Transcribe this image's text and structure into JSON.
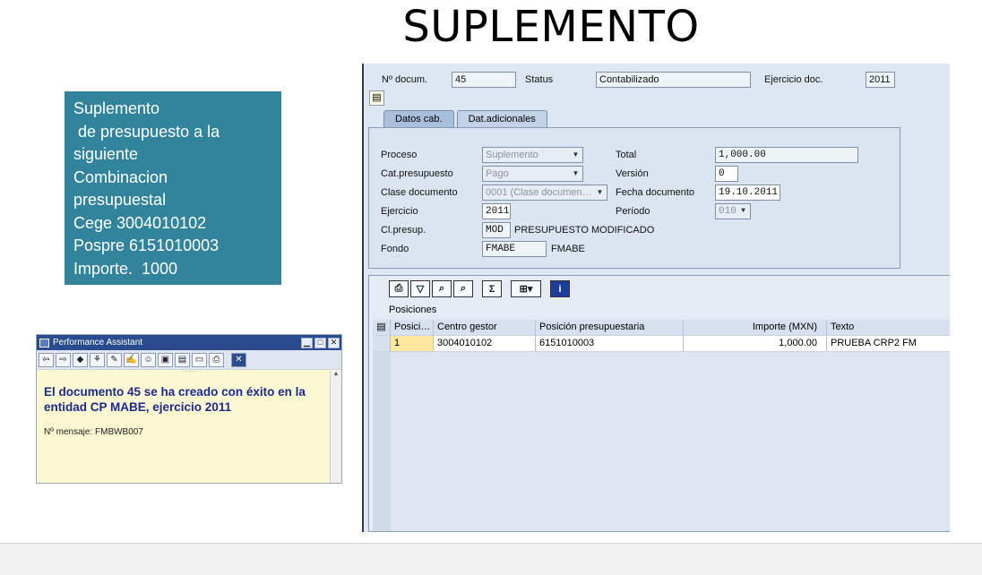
{
  "slide_title": "SUPLEMENTO",
  "note_lines": [
    "Suplemento",
    " de presupuesto a la",
    "siguiente",
    "Combinacion",
    "presupuestal",
    "Cege 3004010102",
    "Pospre 6151010003",
    "Importe.  1000"
  ],
  "performance_assistant": {
    "title": "Performance Assistant",
    "message": "El documento 45 se ha creado con éxito en la entidad CP MABE, ejercicio 2011",
    "message_code": "Nº mensaje: FMBWB007",
    "toolbar_icons": [
      "back-arrow-icon",
      "forward-arrow-icon",
      "technical-info-icon",
      "tree-icon",
      "edit-icon",
      "note-icon",
      "person-icon",
      "book-icon",
      "notepad-icon",
      "print-preview-icon",
      "print-icon",
      "close-icon"
    ]
  },
  "sap_header": {
    "doc_label": "Nº docum.",
    "doc_value": "45",
    "status_label": "Status",
    "status_value": "Contabilizado",
    "fiscal_label": "Ejercicio doc.",
    "fiscal_value": "2011"
  },
  "tabs": [
    {
      "label": "Datos cab.",
      "active": true
    },
    {
      "label": "Dat.adicionales",
      "active": false
    }
  ],
  "form": {
    "proceso_label": "Proceso",
    "proceso_value": "Suplemento",
    "catpres_label": "Cat.presupuesto",
    "catpres_value": "Pago",
    "clasedoc_label": "Clase documento",
    "clasedoc_value": "0001 (Clase documen…",
    "ejercicio_label": "Ejercicio",
    "ejercicio_value": "2011",
    "clpresup_label": "Cl.presup.",
    "clpresup_value": "MOD",
    "clpresup_text": "PRESUPUESTO MODIFICADO",
    "fondo_label": "Fondo",
    "fondo_value": "FMABE",
    "fondo_text": "FMABE",
    "total_label": "Total",
    "total_value": "1,000.00",
    "version_label": "Versión",
    "version_value": "0",
    "fechadoc_label": "Fecha documento",
    "fechadoc_value": "19.10.2011",
    "periodo_label": "Período",
    "periodo_value": "010"
  },
  "positions": {
    "title": "Posiciones",
    "columns": [
      "Posici…",
      "Centro gestor",
      "Posición presupuestaria",
      "Importe (MXN)",
      "Texto"
    ],
    "rows": [
      [
        "1",
        "3004010102",
        "6151010003",
        "1,000.00",
        "PRUEBA CRP2 FM"
      ]
    ],
    "toolbar_icons": [
      "print-icon",
      "filter-icon",
      "find-icon",
      "find-next-icon",
      "sum-icon",
      "layout-icon",
      "info-icon"
    ]
  }
}
